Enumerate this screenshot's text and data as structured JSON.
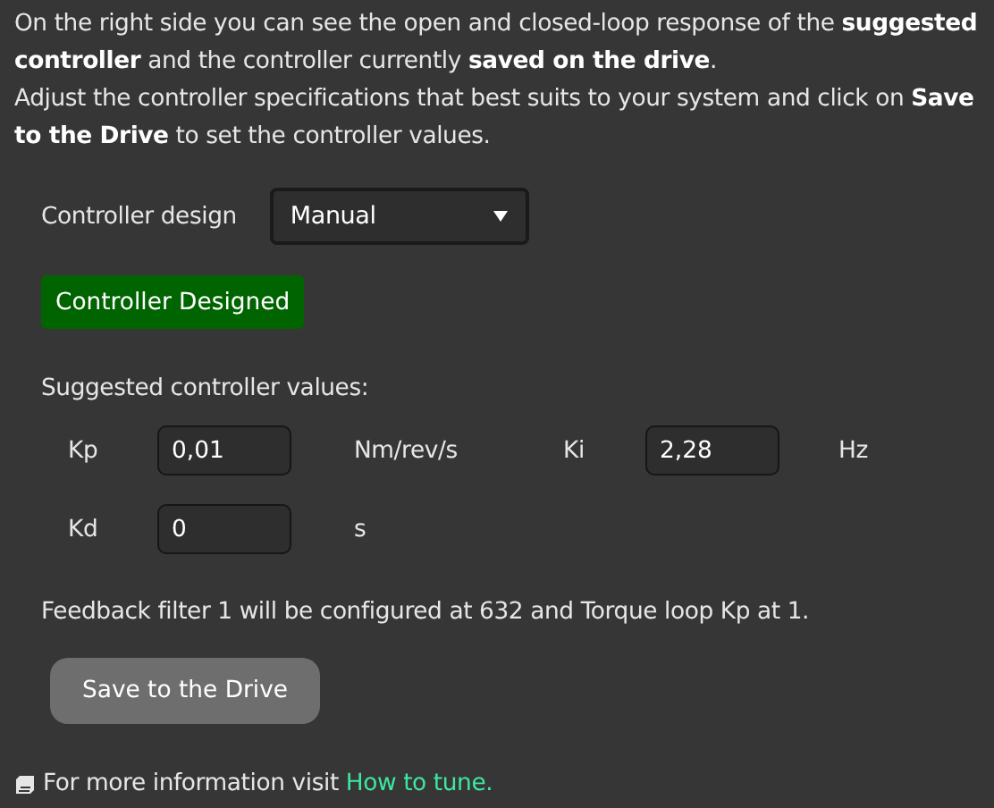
{
  "intro": [
    "On the right side you can see the open and closed-loop response of the **suggested controller** and the controller currently **saved on the drive**.",
    "Adjust the controller specifications that best suits to your system and click on **Save to the Drive** to set the controller values."
  ],
  "design": {
    "label": "Controller design",
    "value": "Manual"
  },
  "status_button": {
    "label": "Controller Designed"
  },
  "suggested_title": "Suggested controller values:",
  "params": [
    {
      "label": "Kp",
      "value": "0,01",
      "unit": "Nm/rev/s"
    },
    {
      "label": "Ki",
      "value": "2,28",
      "unit": "Hz"
    },
    {
      "label": "Kd",
      "value": "0",
      "unit": "s"
    }
  ],
  "note": "Feedback filter 1 will be configured at 632 and Torque loop Kp at 1.",
  "save_button": {
    "label": "Save to the Drive"
  },
  "footer": {
    "text": "For more information visit ",
    "link": "How to tune."
  }
}
